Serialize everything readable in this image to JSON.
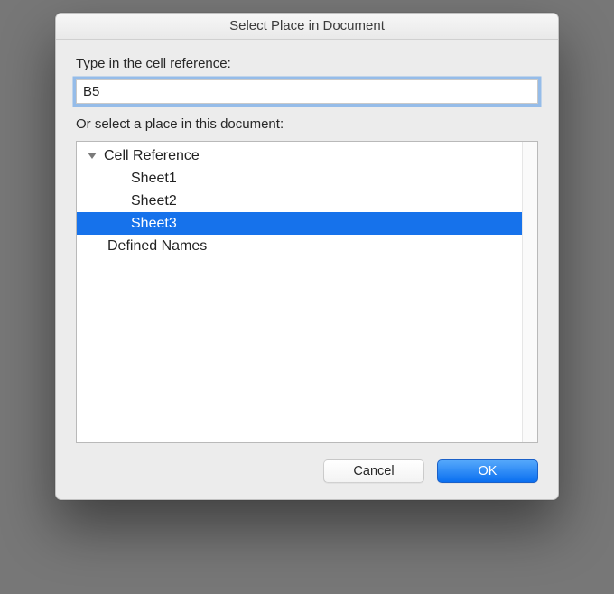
{
  "window": {
    "title": "Select Place in Document"
  },
  "form": {
    "cell_ref_label": "Type in the cell reference:",
    "cell_ref_value": "B5",
    "place_label": "Or select a place in this document:"
  },
  "tree": {
    "root": {
      "label": "Cell Reference",
      "expanded": true,
      "children": [
        {
          "label": "Sheet1"
        },
        {
          "label": "Sheet2"
        },
        {
          "label": "Sheet3",
          "selected": true
        }
      ]
    },
    "siblings": [
      {
        "label": "Defined Names"
      }
    ]
  },
  "buttons": {
    "cancel": "Cancel",
    "ok": "OK"
  },
  "colors": {
    "selection": "#1672eb",
    "focus_ring": "#7eb0e8",
    "window_bg": "#ececec"
  }
}
